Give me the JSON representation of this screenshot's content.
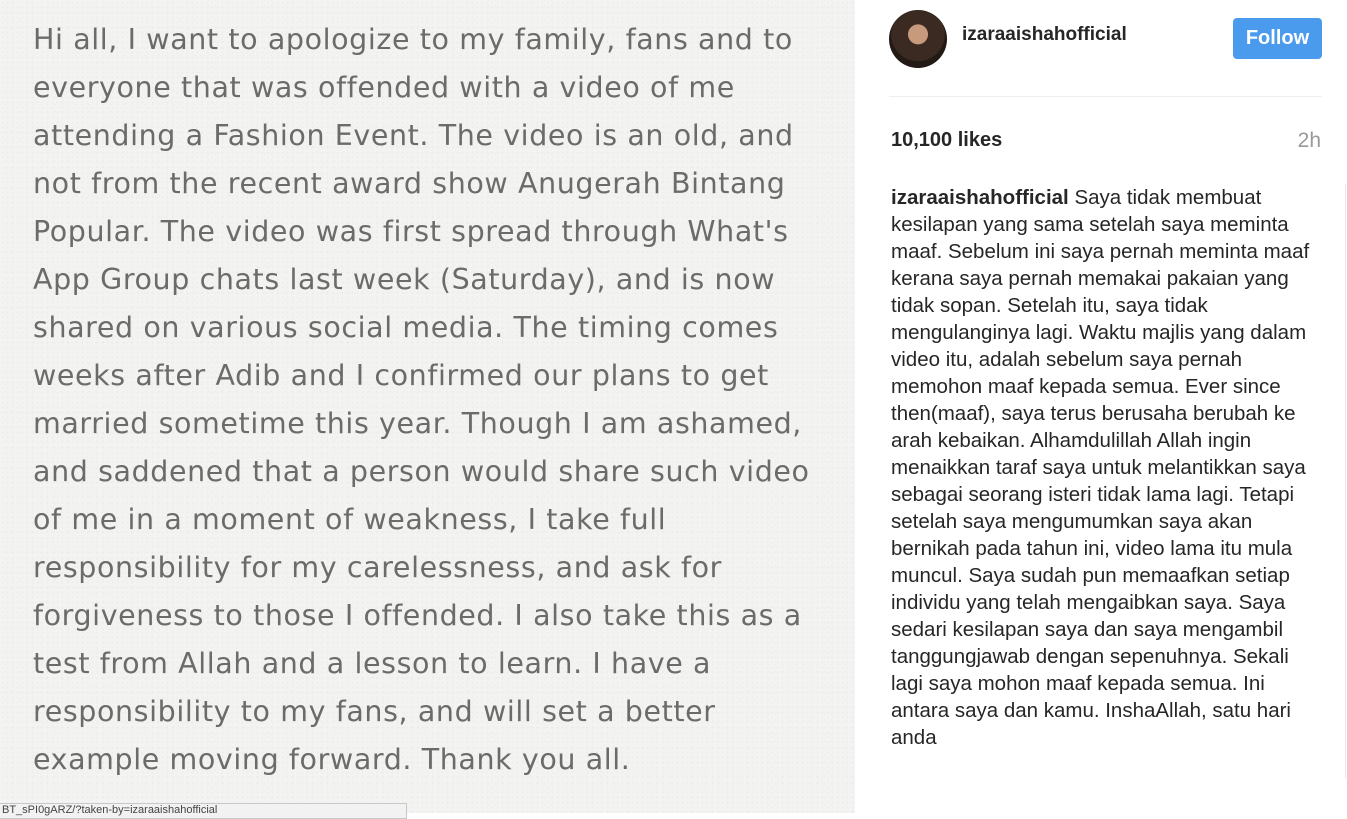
{
  "post": {
    "image_text": "Hi all, I want to apologize to my family, fans and to\neveryone that was offended with a video of me\nattending a Fashion Event. The video is an old, and\nnot from the recent award show Anugerah Bintang\nPopular. The video was first spread through What's\nApp Group chats last week (Saturday), and is now\nshared on various social media. The timing comes\nweeks after Adib and I confirmed our plans to get\nmarried sometime this year. Though I am ashamed,\nand saddened that a person would share such video\nof me in a moment of weakness, I take full\nresponsibility for my carelessness, and ask for\nforgiveness to those I offended. I also take this as a\ntest from Allah and a lesson to learn. I have a\nresponsibility to my fans, and will set a better\nexample moving forward. Thank you all."
  },
  "status_bar": {
    "url": "BT_sPI0gARZ/?taken-by=izaraaishahofficial"
  },
  "header": {
    "avatar_icon": "profile-avatar",
    "username": "izaraaishahofficial",
    "follow_label": "Follow",
    "follow_color": "#4a9bee"
  },
  "stats": {
    "likes": "10,100 likes",
    "time": "2h"
  },
  "caption": {
    "user": "izaraaishahofficial",
    "text": "Saya tidak membuat kesilapan yang sama setelah saya meminta maaf. Sebelum ini saya pernah meminta maaf kerana saya pernah memakai pakaian yang tidak sopan. Setelah itu, saya tidak mengulanginya lagi. Waktu majlis yang dalam video itu, adalah sebelum saya pernah memohon maaf kepada semua. Ever since then(maaf), saya terus berusaha berubah ke arah kebaikan. Alhamdulillah Allah ingin menaikkan taraf saya untuk melantikkan saya sebagai seorang isteri tidak lama lagi. Tetapi setelah saya mengumumkan saya akan bernikah pada tahun ini, video lama itu mula muncul. Saya sudah pun memaafkan setiap individu yang telah mengaibkan saya. Saya sedari kesilapan saya dan saya mengambil tanggungjawab dengan sepenuhnya. Sekali lagi saya mohon maaf kepada semua. Ini antara saya dan kamu. InshaAllah, satu hari anda"
  }
}
